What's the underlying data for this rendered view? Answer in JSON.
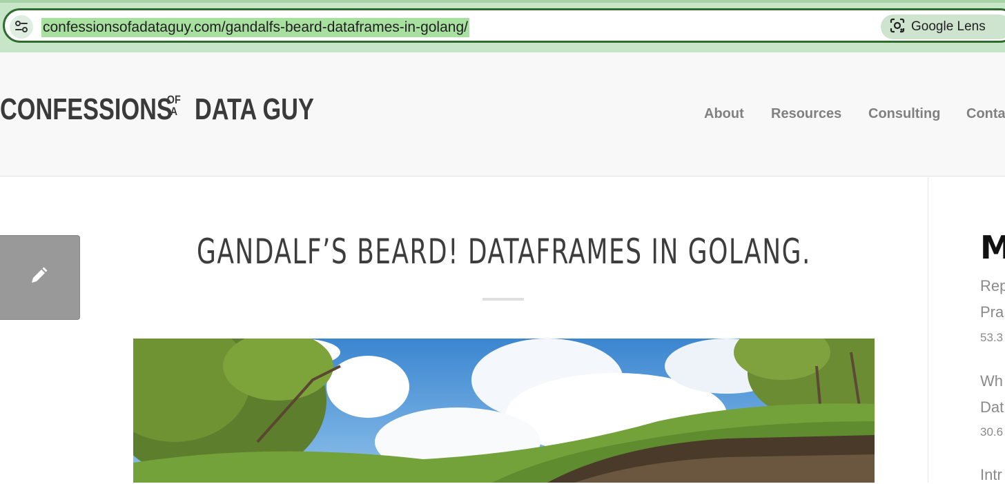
{
  "browser": {
    "url": "confessionsofadataguy.com/gandalfs-beard-dataframes-in-golang/",
    "lens_label": "Google Lens",
    "site_info_icon": "tune-icon",
    "lens_icon": "google-lens-icon"
  },
  "site": {
    "logo_left": "CONFESSIONS",
    "logo_of": "OF",
    "logo_a": "A",
    "logo_right": "DATA GUY",
    "nav": [
      "About",
      "Resources",
      "Consulting",
      "Conta"
    ]
  },
  "post": {
    "title": "GANDALF’S BEARD! DATAFRAMES IN GOLANG.",
    "edit_icon": "pencil-icon"
  },
  "sidebar": {
    "heading": "MC",
    "items": [
      {
        "line1": "Rep",
        "line2": "Pra",
        "meta": "53.3"
      },
      {
        "line1": "Wh",
        "line2": "Dat",
        "meta": "30.6"
      },
      {
        "line1": "Intr"
      }
    ]
  },
  "colors": {
    "chrome": "#c7e6c7",
    "url_highlight": "#a8e0a0",
    "header_bg": "#f8f8f8",
    "title": "#3d3d3d",
    "nav": "#808080"
  }
}
